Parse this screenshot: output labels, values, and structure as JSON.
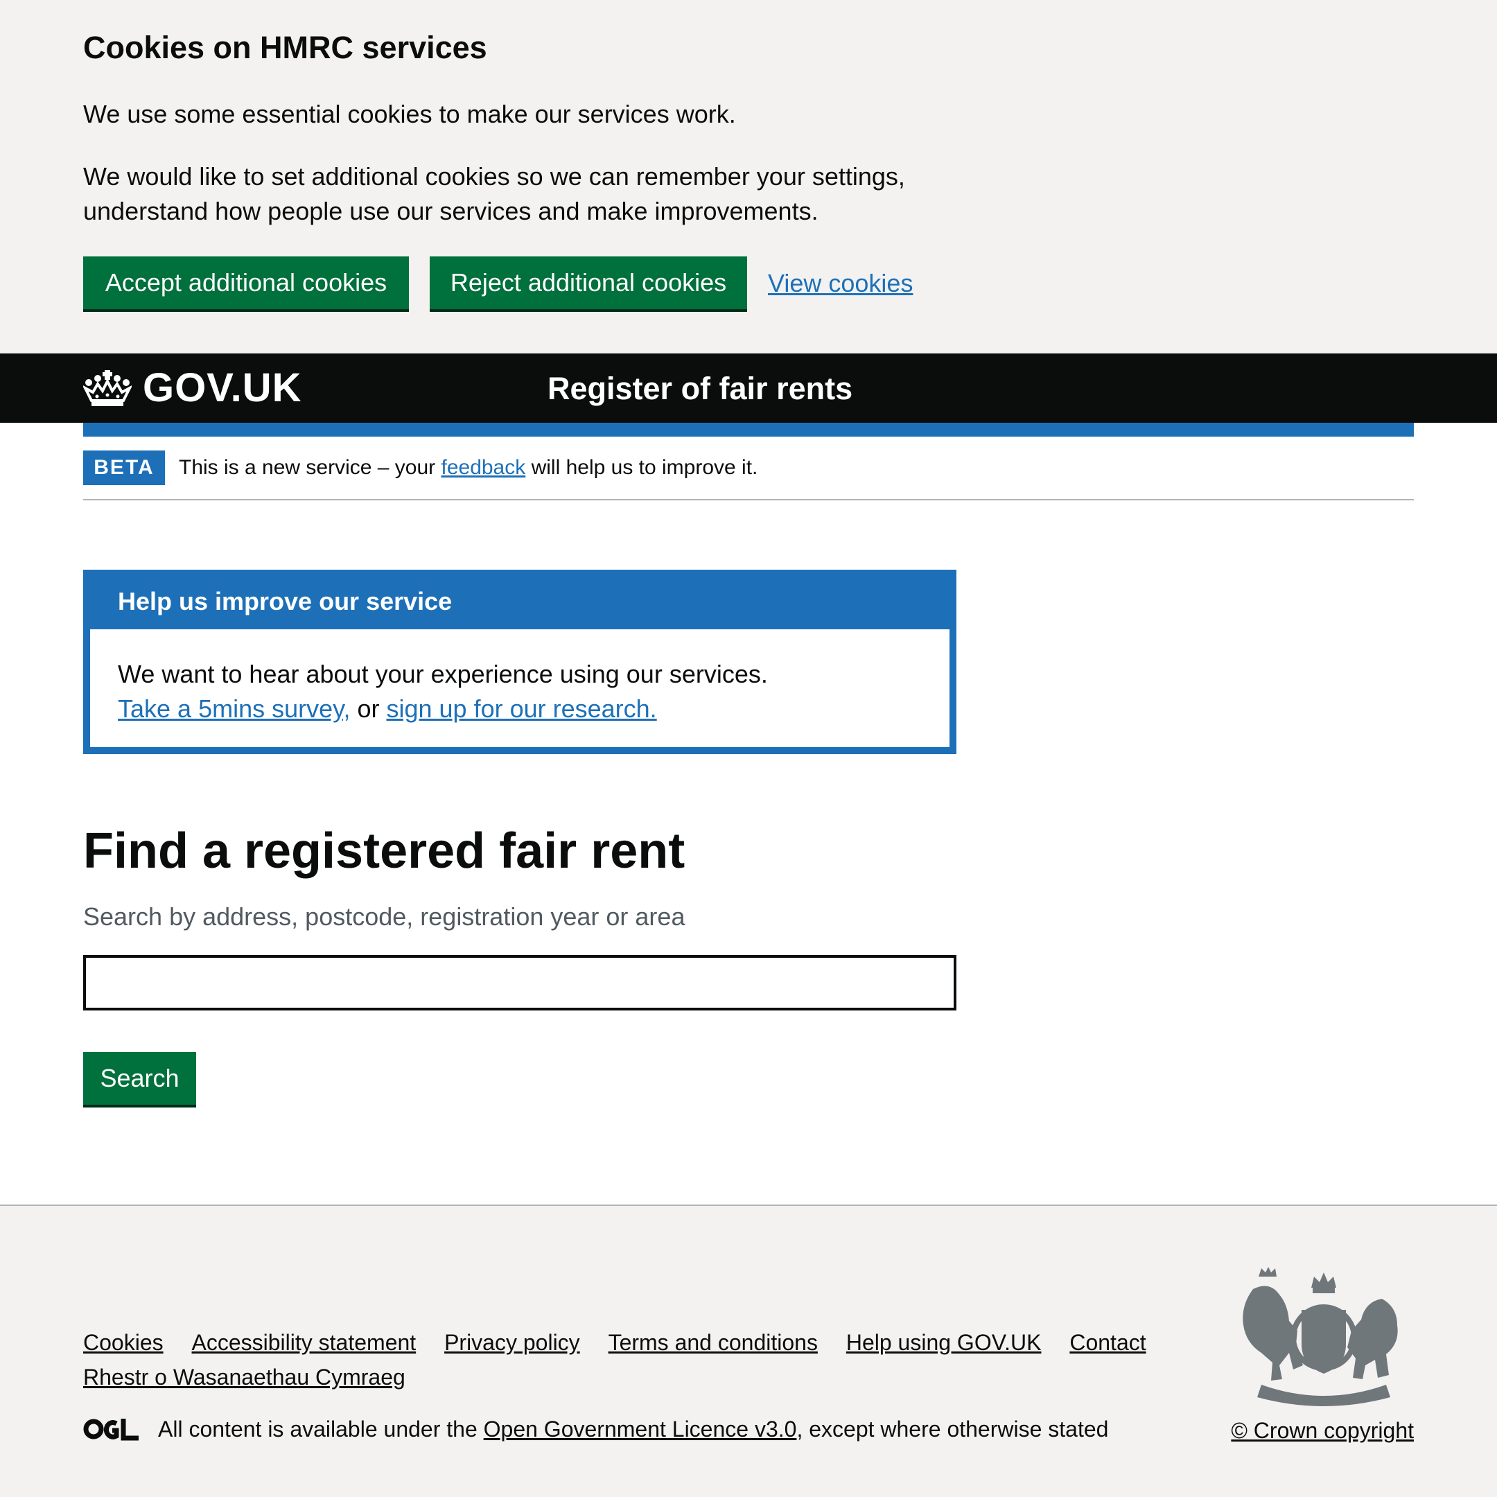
{
  "cookie_banner": {
    "title": "Cookies on HMRC services",
    "paragraph1": "We use some essential cookies to make our services work.",
    "paragraph2": "We would like to set additional cookies so we can remember your settings, understand how people use our services and make improvements.",
    "accept_label": "Accept additional cookies",
    "reject_label": "Reject additional cookies",
    "view_label": "View cookies"
  },
  "header": {
    "logo_text": "GOV.UK",
    "service_name": "Register of fair rents"
  },
  "phase_banner": {
    "tag": "BETA",
    "text_before": "This is a new service – your ",
    "link": "feedback",
    "text_after": " will help us to improve it."
  },
  "help_box": {
    "title": "Help us improve our service",
    "body": "We want to hear about your experience using our services.",
    "survey_link": "Take a 5mins survey,",
    "or_text": " or ",
    "research_link": "sign up for our research."
  },
  "main": {
    "title": "Find a registered fair rent",
    "hint": "Search by address, postcode, registration year or area",
    "search_value": "",
    "search_button": "Search"
  },
  "footer": {
    "links": [
      "Cookies",
      "Accessibility statement",
      "Privacy policy",
      "Terms and conditions",
      "Help using GOV.UK",
      "Contact",
      "Rhestr o Wasanaethau Cymraeg"
    ],
    "licence_before": "All content is available under the ",
    "licence_link": "Open Government Licence v3.0",
    "licence_after": ", except where otherwise stated",
    "copyright": "© Crown copyright"
  },
  "icons": {
    "crown": "crown-icon",
    "ogl": "ogl-logo-icon",
    "crest": "royal-coat-of-arms-icon"
  },
  "colors": {
    "green_button": "#00703c",
    "link_blue": "#1d70b8",
    "header_black": "#0b0c0c",
    "banner_grey": "#f3f2f1"
  }
}
